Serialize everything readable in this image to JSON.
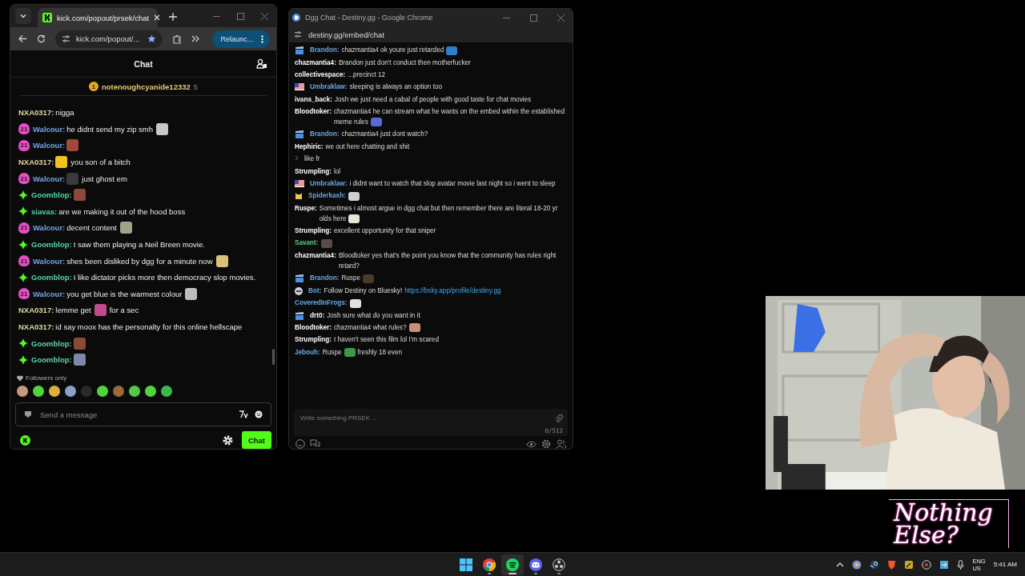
{
  "kick_window": {
    "tab_title": "kick.com/popout/prsek/chat",
    "address": "kick.com/popout/...",
    "relaunch": "Relaunc...",
    "header": "Chat",
    "pinned": {
      "badge": "1",
      "user": "notenoughcyanide12332",
      "count": "5"
    },
    "messages": [
      {
        "badge": {
          "kind": "none"
        },
        "user": "NXA0317:",
        "color": "#ddd79c",
        "parts": [
          {
            "kind": "text",
            "text": "nigga"
          }
        ]
      },
      {
        "badge": {
          "kind": "sub",
          "text": "21"
        },
        "user": "Walcour:",
        "color": "#74a6ea",
        "parts": [
          {
            "kind": "text",
            "text": "he didnt send my zip smh"
          },
          {
            "kind": "emote",
            "color": "#c8c8c8"
          }
        ]
      },
      {
        "badge": {
          "kind": "sub",
          "text": "21"
        },
        "user": "Walcour:",
        "color": "#74a6ea",
        "parts": [
          {
            "kind": "emote",
            "color": "#a0483a"
          }
        ]
      },
      {
        "badge": {
          "kind": "none"
        },
        "user": "NXA0317:",
        "color": "#ddd79c",
        "parts": [
          {
            "kind": "emote",
            "color": "#f2c21c"
          },
          {
            "kind": "text",
            "text": "you son of a bitch"
          }
        ]
      },
      {
        "badge": {
          "kind": "sub",
          "text": "21"
        },
        "user": "Walcour:",
        "color": "#74a6ea",
        "parts": [
          {
            "kind": "emote",
            "color": "#3a3a3a"
          },
          {
            "kind": "text",
            "text": "just ghost em"
          }
        ]
      },
      {
        "badge": {
          "kind": "star"
        },
        "user": "Goomblop:",
        "color": "#55d7a0",
        "parts": [
          {
            "kind": "emote",
            "color": "#8a4a3a"
          }
        ]
      },
      {
        "badge": {
          "kind": "star"
        },
        "user": "siavas:",
        "color": "#55d7a0",
        "parts": [
          {
            "kind": "text",
            "text": "are we making it out of the hood boss"
          }
        ]
      },
      {
        "badge": {
          "kind": "sub",
          "text": "21"
        },
        "user": "Walcour:",
        "color": "#74a6ea",
        "parts": [
          {
            "kind": "text",
            "text": "decent content"
          },
          {
            "kind": "emote",
            "color": "#9aa58a"
          }
        ]
      },
      {
        "badge": {
          "kind": "star"
        },
        "user": "Goomblop:",
        "color": "#55d7a0",
        "parts": [
          {
            "kind": "text",
            "text": "I saw them playing a Neil Breen movie."
          }
        ]
      },
      {
        "badge": {
          "kind": "sub",
          "text": "21"
        },
        "user": "Walcour:",
        "color": "#74a6ea",
        "parts": [
          {
            "kind": "text",
            "text": "shes been disliked by dgg for a minute now"
          },
          {
            "kind": "emote",
            "color": "#d8c27a"
          }
        ]
      },
      {
        "badge": {
          "kind": "star"
        },
        "user": "Goomblop:",
        "color": "#55d7a0",
        "parts": [
          {
            "kind": "text",
            "text": "I like dictator picks more then democracy slop movies."
          }
        ]
      },
      {
        "badge": {
          "kind": "sub",
          "text": "21"
        },
        "user": "Walcour:",
        "color": "#74a6ea",
        "parts": [
          {
            "kind": "text",
            "text": "you get blue is the warmest colour"
          },
          {
            "kind": "emote",
            "color": "#bdbdbd"
          }
        ]
      },
      {
        "badge": {
          "kind": "none"
        },
        "user": "NXA0317:",
        "color": "#ddd79c",
        "parts": [
          {
            "kind": "text",
            "text": "lemme get"
          },
          {
            "kind": "emote",
            "color": "#c24a8a"
          },
          {
            "kind": "text",
            "text": "for a sec"
          }
        ]
      },
      {
        "badge": {
          "kind": "none"
        },
        "user": "NXA0317:",
        "color": "#ddd79c",
        "parts": [
          {
            "kind": "text",
            "text": "id say moox has the personalty for this online hellscape"
          }
        ]
      },
      {
        "badge": {
          "kind": "star"
        },
        "user": "Goomblop:",
        "color": "#55d7a0",
        "parts": [
          {
            "kind": "emote",
            "color": "#8a4a3a"
          }
        ]
      },
      {
        "badge": {
          "kind": "star"
        },
        "user": "Goomblop:",
        "color": "#55d7a0",
        "parts": [
          {
            "kind": "emote",
            "color": "#7a8aa8"
          }
        ]
      }
    ],
    "mode": "Followers only",
    "emote_strip": [
      {
        "color": "#c49a7a"
      },
      {
        "color": "#53d33a"
      },
      {
        "color": "#d8b03a"
      },
      {
        "color": "#8aa0c8"
      },
      {
        "color": "#2a2a2a"
      },
      {
        "color": "#53d33a"
      },
      {
        "color": "#9a6a3a"
      },
      {
        "color": "#53c84a"
      },
      {
        "color": "#53d33a"
      },
      {
        "color": "#3ab84a"
      }
    ],
    "input": {
      "placeholder": "Send a message"
    },
    "send_button": "Chat"
  },
  "dgg_window": {
    "title": "Dgg Chat - Destiny.gg - Google Chrome",
    "address": "destiny.gg/embed/chat",
    "messages": [
      {
        "kind": "clapper",
        "user": "Brandon:",
        "color": "#6aa6e6",
        "parts": [
          {
            "kind": "text",
            "text": "chazmantia4 ok youre just retarded"
          },
          {
            "kind": "emote",
            "color": "#2f7fd0"
          }
        ]
      },
      {
        "kind": "plain",
        "user": "chazmantia4:",
        "color": "#ffffff",
        "parts": [
          {
            "kind": "text",
            "text": "Brandon just don't conduct then motherfucker"
          }
        ]
      },
      {
        "kind": "plain",
        "user": "collectivespace:",
        "color": "#ffffff",
        "parts": [
          {
            "kind": "text",
            "text": "...precinct 12"
          }
        ]
      },
      {
        "kind": "flag",
        "user": "Umbraklaw:",
        "color": "#6aa6e6",
        "parts": [
          {
            "kind": "text",
            "text": "sleeping is always an option too"
          }
        ]
      },
      {
        "kind": "plain",
        "user": "ivans_back:",
        "color": "#ffffff",
        "parts": [
          {
            "kind": "text",
            "text": "Josh we just need a cabal of people with good taste for chat movies"
          }
        ]
      },
      {
        "kind": "plain",
        "user": "Bloodtoker:",
        "color": "#ffffff",
        "parts": [
          {
            "kind": "text",
            "text": "chazmantia4 he can stream what he wants on the embed within the established meme rules"
          },
          {
            "kind": "emote",
            "color": "#5a6ad8"
          }
        ]
      },
      {
        "kind": "clapper",
        "user": "Brandon:",
        "color": "#6aa6e6",
        "parts": [
          {
            "kind": "text",
            "text": "chazmantia4 just dont watch?"
          }
        ]
      },
      {
        "kind": "plain",
        "user": "Hephiric:",
        "color": "#ffffff",
        "parts": [
          {
            "kind": "text",
            "text": "we out here chatting and shit"
          }
        ]
      },
      {
        "kind": "continued",
        "parts": [
          {
            "kind": "text",
            "text": "like fr"
          }
        ]
      },
      {
        "kind": "plain",
        "user": "Strumpling:",
        "color": "#ffffff",
        "parts": [
          {
            "kind": "text",
            "text": "lol"
          }
        ]
      },
      {
        "kind": "flag",
        "user": "Umbraklaw:",
        "color": "#6aa6e6",
        "parts": [
          {
            "kind": "text",
            "text": "i didnt want to watch that slop avatar movie last night so i went to sleep"
          }
        ]
      },
      {
        "kind": "cat",
        "user": "Spiderkash:",
        "color": "#6aa6e6",
        "parts": [
          {
            "kind": "emote",
            "color": "#d0d0d0"
          }
        ]
      },
      {
        "kind": "plain",
        "user": "Ruspe:",
        "color": "#ffffff",
        "parts": [
          {
            "kind": "text",
            "text": "Sometimes i almost argue in dgg chat but then remember there are literal 18-20 yr olds here"
          },
          {
            "kind": "emote",
            "color": "#e8e4d8"
          }
        ]
      },
      {
        "kind": "plain",
        "user": "Strumpling:",
        "color": "#ffffff",
        "parts": [
          {
            "kind": "text",
            "text": "excellent opportunity for that sniper"
          }
        ]
      },
      {
        "kind": "plain",
        "user": "Savant:",
        "color": "#4fd08a",
        "parts": [
          {
            "kind": "emote",
            "color": "#5a4a4a"
          }
        ]
      },
      {
        "kind": "plain",
        "user": "chazmantia4:",
        "color": "#ffffff",
        "parts": [
          {
            "kind": "text",
            "text": "Bloodtoker yes that's the point you know that the community has rules right retard?"
          }
        ]
      },
      {
        "kind": "clapper",
        "user": "Brandon:",
        "color": "#6aa6e6",
        "parts": [
          {
            "kind": "text",
            "text": "Ruspe"
          },
          {
            "kind": "emote",
            "color": "#4a3a2a"
          }
        ]
      },
      {
        "kind": "bot",
        "user": "Bot:",
        "color": "#6aa6e6",
        "parts": [
          {
            "kind": "text",
            "text": "Follow Destiny on Bluesky!"
          },
          {
            "kind": "link",
            "text": "https://bsky.app/profile/destiny.gg"
          }
        ]
      },
      {
        "kind": "plain",
        "user": "CoveredInFrogs:",
        "color": "#6aa6e6",
        "parts": [
          {
            "kind": "emote",
            "color": "#e0e0e8"
          }
        ]
      },
      {
        "kind": "clapper",
        "user": "drt0:",
        "color": "#ffffff",
        "parts": [
          {
            "kind": "text",
            "text": "Josh sure what do you want in it"
          }
        ]
      },
      {
        "kind": "plain",
        "user": "Bloodtoker:",
        "color": "#ffffff",
        "parts": [
          {
            "kind": "text",
            "text": "chazmantia4 what rules?"
          },
          {
            "kind": "emote",
            "color": "#c8907a"
          }
        ]
      },
      {
        "kind": "plain",
        "user": "Strumpling:",
        "color": "#ffffff",
        "parts": [
          {
            "kind": "text",
            "text": "I haven't seen this film lol I'm scared"
          }
        ]
      },
      {
        "kind": "plain",
        "user": "Jebouh:",
        "color": "#6aa6e6",
        "parts": [
          {
            "kind": "text",
            "text": "Ruspe"
          },
          {
            "kind": "emote",
            "color": "#3a9a4a"
          },
          {
            "kind": "text",
            "text": "freshly 18 even"
          }
        ]
      }
    ],
    "input": {
      "placeholder": "Write something PRSEK ...",
      "counter": "0/512"
    }
  },
  "overlay_logo": "Nothing Else?",
  "taskbar": {
    "apps": [
      {
        "kind": "start",
        "running": false,
        "selected": false
      },
      {
        "kind": "chrome",
        "running": true,
        "selected": false
      },
      {
        "kind": "spotify",
        "running": true,
        "selected": true
      },
      {
        "kind": "discord",
        "running": true,
        "selected": false
      },
      {
        "kind": "obs",
        "running": true,
        "selected": false
      }
    ],
    "language": "ENG",
    "region": "US",
    "time": "5:41 AM"
  }
}
